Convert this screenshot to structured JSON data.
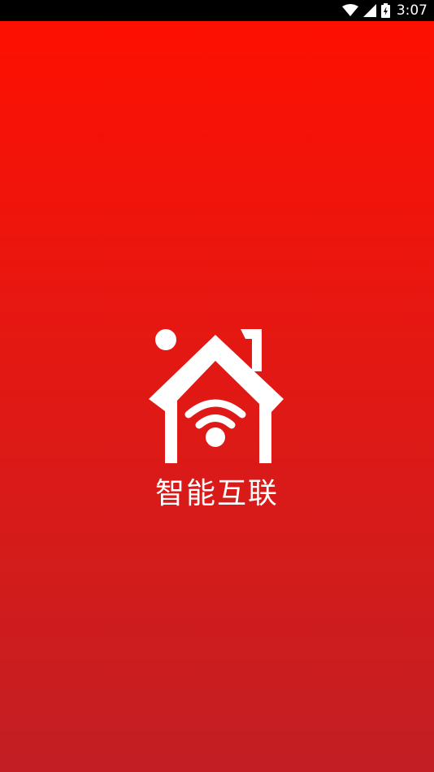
{
  "status_bar": {
    "time": "3:07",
    "icons": [
      "wifi-icon",
      "cell-signal-icon",
      "battery-icon"
    ]
  },
  "splash": {
    "app_name": "智能互联",
    "logo_icon": "smart-home-wifi-icon"
  },
  "colors": {
    "background_top": "#ff0f00",
    "background_bottom": "#c21e24",
    "status_bar": "#000000",
    "foreground": "#ffffff"
  }
}
